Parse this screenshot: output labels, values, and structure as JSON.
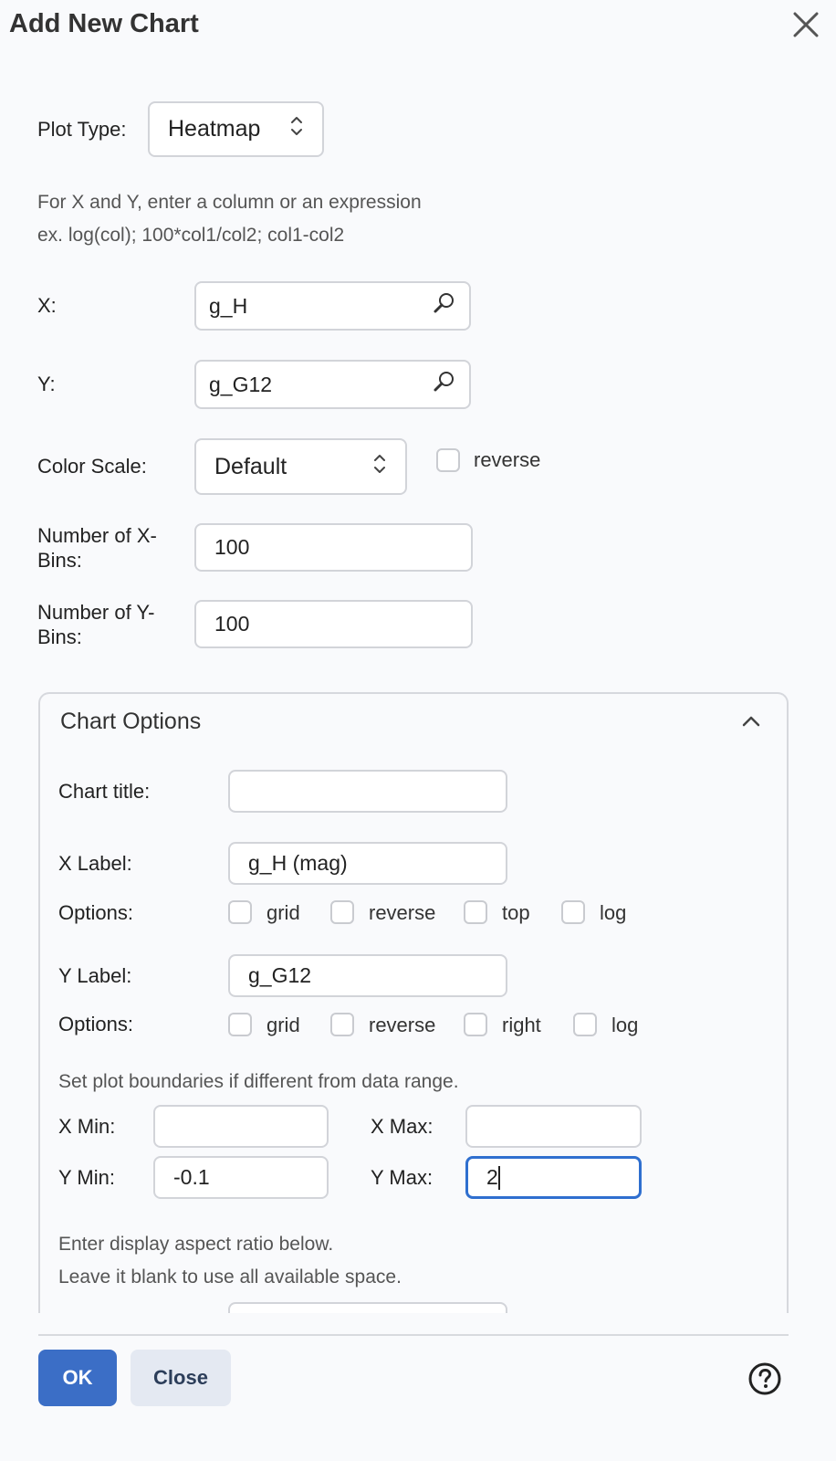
{
  "dialog": {
    "title": "Add New Chart"
  },
  "plot_type": {
    "label": "Plot Type:",
    "value": "Heatmap"
  },
  "hint": {
    "line1": "For X and Y, enter a column or an expression",
    "line2": "ex. log(col); 100*col1/col2; col1-col2"
  },
  "x": {
    "label": "X:",
    "value": "g_H"
  },
  "y": {
    "label": "Y:",
    "value": "g_G12"
  },
  "color_scale": {
    "label": "Color Scale:",
    "value": "Default",
    "reverse_label": "reverse"
  },
  "x_bins": {
    "label_line1": "Number of X-",
    "label_line2": "Bins:",
    "value": "100"
  },
  "y_bins": {
    "label_line1": "Number of Y-",
    "label_line2": "Bins:",
    "value": "100"
  },
  "chart_options": {
    "header": "Chart Options",
    "chart_title": {
      "label": "Chart title:",
      "value": ""
    },
    "x_label": {
      "label": "X Label:",
      "value": "g_H (mag)"
    },
    "x_options": {
      "label": "Options:",
      "grid": "grid",
      "reverse": "reverse",
      "top": "top",
      "log": "log"
    },
    "y_label": {
      "label": "Y Label:",
      "value": "g_G12"
    },
    "y_options": {
      "label": "Options:",
      "grid": "grid",
      "reverse": "reverse",
      "right": "right",
      "log": "log"
    },
    "boundaries_hint": "Set plot boundaries if different from data range.",
    "x_min": {
      "label": "X Min:",
      "value": ""
    },
    "x_max": {
      "label": "X Max:",
      "value": ""
    },
    "y_min": {
      "label": "Y Min:",
      "value": "-0.1"
    },
    "y_max": {
      "label": "Y Max:",
      "value": "2"
    },
    "aspect_hint_line1": "Enter display aspect ratio below.",
    "aspect_hint_line2": "Leave it blank to use all available space."
  },
  "footer": {
    "ok_label": "OK",
    "close_label": "Close"
  },
  "colors": {
    "primary": "#3b6ec6",
    "focus": "#2f6fcf",
    "secondary_bg": "#e4e9f2"
  }
}
